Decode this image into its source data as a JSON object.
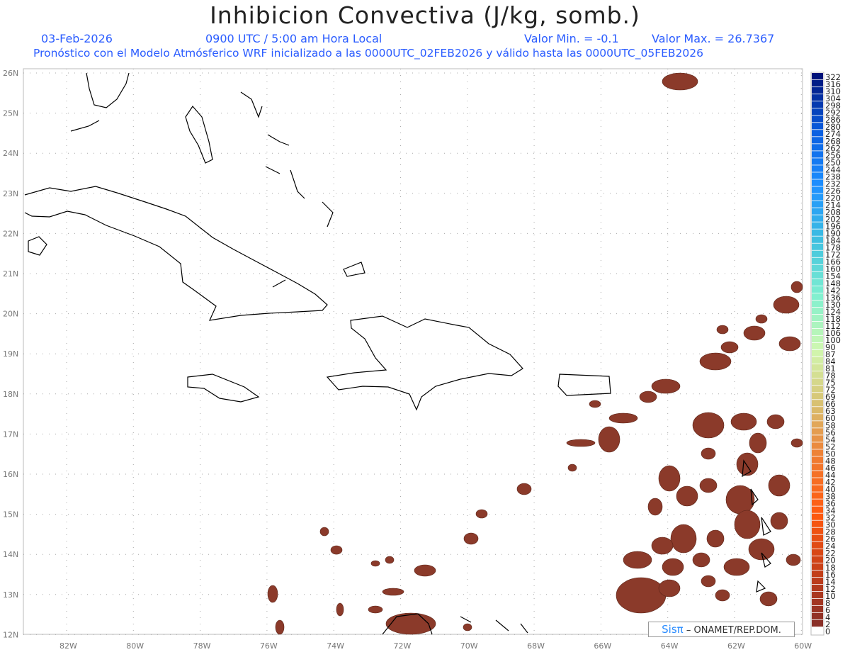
{
  "title": "Inhibicion Convectiva (J/kg, somb.)",
  "header": {
    "date": "03-Feb-2026",
    "time": "0900 UTC / 5:00 am Hora Local",
    "valor_min": "Valor Min. = -0.1",
    "valor_max": "Valor Max. = 26.7367",
    "subtitle": "Pronóstico con el Modelo Atmósferico WRF inicializado a las 0000UTC_02FEB2026 y válido hasta las  0000UTC_05FEB2026"
  },
  "axes": {
    "lat_labels": [
      "26N",
      "25N",
      "24N",
      "23N",
      "22N",
      "21N",
      "20N",
      "19N",
      "18N",
      "17N",
      "16N",
      "15N",
      "14N",
      "13N",
      "12N"
    ],
    "lon_labels": [
      "82W",
      "80W",
      "78W",
      "76W",
      "74W",
      "72W",
      "70W",
      "68W",
      "66W",
      "64W",
      "62W",
      "60W"
    ]
  },
  "colorbar": {
    "labels": [
      "322",
      "316",
      "310",
      "304",
      "298",
      "292",
      "286",
      "280",
      "274",
      "268",
      "262",
      "256",
      "250",
      "244",
      "238",
      "232",
      "226",
      "220",
      "214",
      "208",
      "202",
      "196",
      "190",
      "184",
      "178",
      "172",
      "166",
      "160",
      "154",
      "148",
      "142",
      "136",
      "130",
      "124",
      "118",
      "112",
      "106",
      "100",
      "90",
      "87",
      "84",
      "81",
      "78",
      "75",
      "72",
      "69",
      "66",
      "63",
      "60",
      "58",
      "56",
      "54",
      "52",
      "50",
      "48",
      "46",
      "44",
      "42",
      "40",
      "38",
      "36",
      "34",
      "32",
      "30",
      "28",
      "26",
      "24",
      "22",
      "20",
      "18",
      "16",
      "14",
      "12",
      "10",
      "8",
      "6",
      "4",
      "2",
      "0"
    ],
    "stops": [
      "#00137a",
      "#0a5ee0",
      "#1e90ff",
      "#3fc0e0",
      "#80f0d0",
      "#d0f8b0",
      "#d8c070",
      "#f07a30",
      "#ff5a10",
      "#c84018",
      "#8a3028",
      "#ffffff"
    ]
  },
  "field_color": "#8b3a2a",
  "credit": {
    "brand": "Sisπ",
    "text": "– ONAMET/REP.DOM."
  }
}
